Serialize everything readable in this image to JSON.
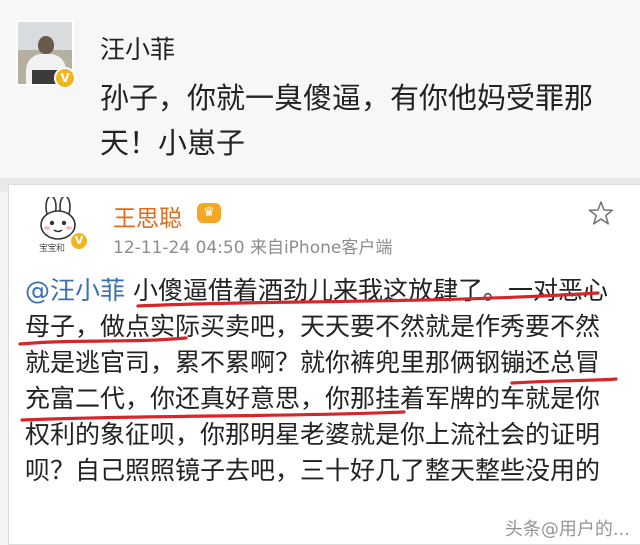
{
  "post1": {
    "username": "汪小菲",
    "verified_badge": "V",
    "message": "孙子，你就一臭傻逼，有你他妈受罪那天！小崽子"
  },
  "post2": {
    "username": "王思聪",
    "verified_badge": "V",
    "avatar_caption": "宝宝和",
    "meta": "12-11-24 04:50  来自iPhone客户端",
    "mention": "@汪小菲",
    "segments": [
      {
        "text": " 小傻逼借着酒劲儿来我这放肆了。一对恶心母子，",
        "underlined": true
      },
      {
        "text": "做点实际买卖吧，天天要不然就是作秀要不然就是逃官司，累不累啊？",
        "underlined": false
      },
      {
        "text": "就你裤兜里那俩钢镚还总冒充富二代",
        "underlined": true
      },
      {
        "text": "，你还真好意思，你那挂着军牌的车就是你权利的象征呗，你那明星老婆就是你上流社会的证明呗？自己照照镜子去吧，三十好几了整天整些没用的",
        "underlined": false
      }
    ]
  },
  "icons": {
    "favorite": "star-outline-icon",
    "avatar2": "bunny-cartoon-icon",
    "level": "crown-badge-icon"
  },
  "colors": {
    "username2": "#e06b1a",
    "mention": "#3a6fb0",
    "underline": "#d7262b",
    "verified": "#f2b51d"
  },
  "watermark": "头条@用户的..."
}
